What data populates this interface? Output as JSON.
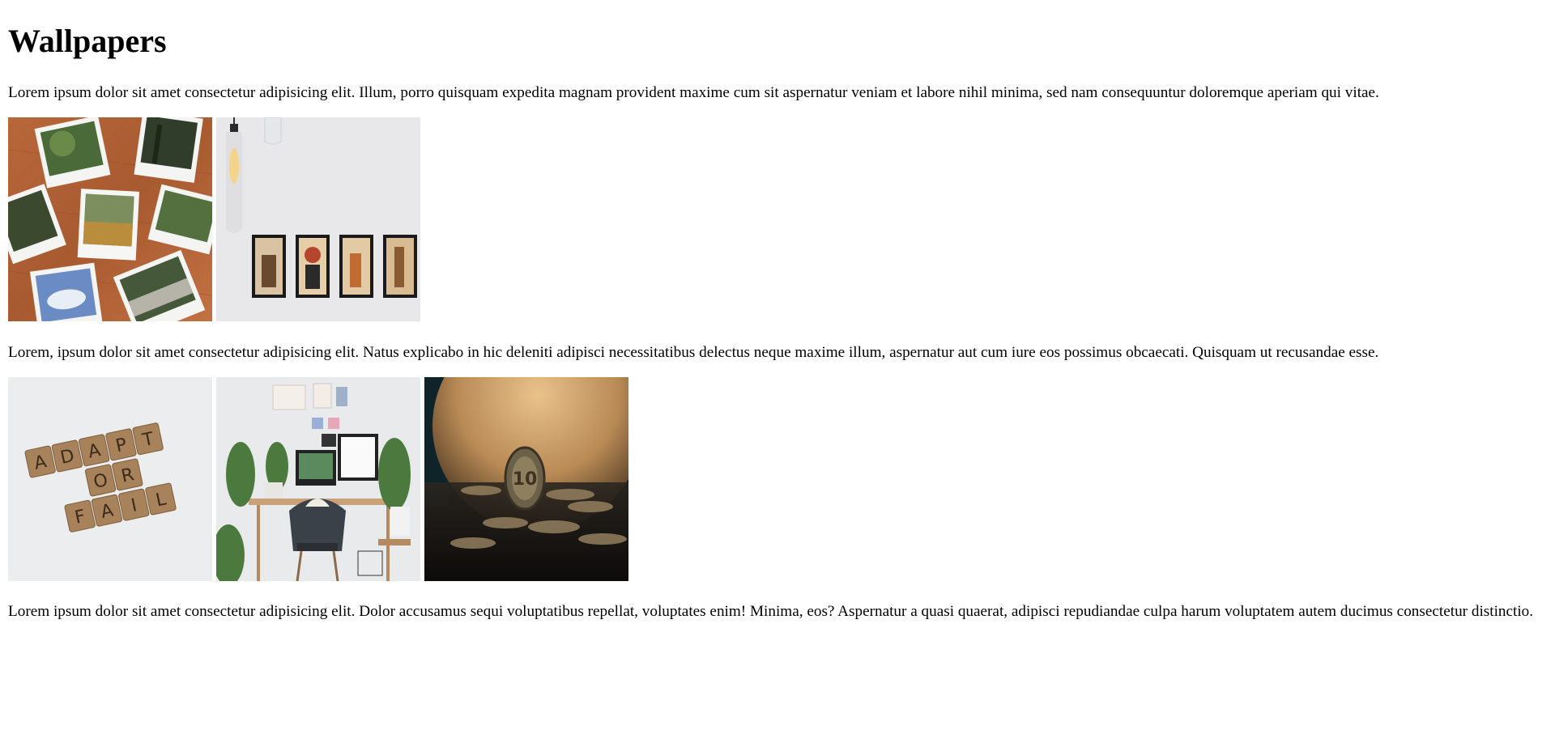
{
  "page": {
    "title": "Wallpapers",
    "paragraphs": [
      "Lorem ipsum dolor sit amet consectetur adipisicing elit. Illum, porro quisquam expedita magnam provident maxime cum sit aspernatur veniam et labore nihil minima, sed nam consequuntur doloremque aperiam qui vitae.",
      "Lorem, ipsum dolor sit amet consectetur adipisicing elit. Natus explicabo in hic deleniti adipisci necessitatibus delectus neque maxime illum, aspernatur aut cum iure eos possimus obcaecati. Quisquam ut recusandae esse.",
      "Lorem ipsum dolor sit amet consectetur adipisicing elit. Dolor accusamus sequi voluptatibus repellat, voluptates enim! Minima, eos? Aspernatur a quasi quaerat, adipisci repudiandae culpa harum voluptatem autem ducimus consectetur distinctio."
    ]
  },
  "gallery": {
    "row1": [
      {
        "name": "polaroid-photos-image"
      },
      {
        "name": "framed-pictures-lamp-image"
      }
    ],
    "row2": [
      {
        "name": "scrabble-adapt-or-fail-image",
        "tiles_text": [
          "A",
          "D",
          "A",
          "P",
          "T",
          "O",
          "R",
          "F",
          "A",
          "I",
          "L"
        ]
      },
      {
        "name": "desk-workspace-image"
      },
      {
        "name": "coin-moon-image",
        "coin_text": "10"
      }
    ]
  }
}
